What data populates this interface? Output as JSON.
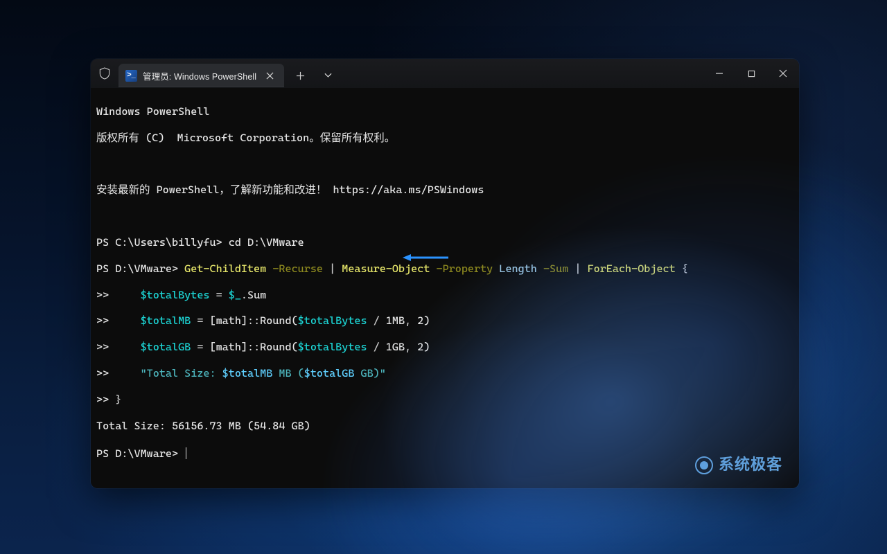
{
  "titlebar": {
    "tab_title": "管理员: Windows PowerShell",
    "ps_glyph": ">_"
  },
  "terminal": {
    "banner1": "Windows PowerShell",
    "banner2": "版权所有 (C)  Microsoft Corporation。保留所有权利。",
    "install_prefix": "安装最新的 PowerShell，了解新功能和改进！",
    "install_url": "https://aka.ms/PSWindows",
    "prompt1": "PS C:\\Users\\billyfu> ",
    "cmd1": "cd D:\\VMware",
    "prompt2": "PS D:\\VMware> ",
    "cont": ">>",
    "tok": {
      "getchilditem": "Get-ChildItem",
      "recurse": "-Recurse",
      "pipe": "|",
      "measure": "Measure-Object",
      "property": "-Property",
      "length": "Length",
      "sum": "-Sum",
      "foreach": "ForEach-Object",
      "lbrace": "{",
      "rbrace": "}",
      "totalBytes": "$totalBytes",
      "totalMB": "$totalMB",
      "totalGB": "$totalGB",
      "eq": " = ",
      "underscore": "$_",
      "dotSum": ".Sum",
      "mathRound": "[math]::Round(",
      "div": " / ",
      "mb": "1MB",
      "gb": "1GB",
      "comma2": ", ",
      "two": "2",
      "rparen": ")",
      "str_open": "\"Total Size: ",
      "str_mb_lbl": " MB (",
      "str_gb_lbl": " GB)\""
    },
    "output": "Total Size: 56156.73 MB (54.84 GB)",
    "prompt3": "PS D:\\VMware> "
  },
  "watermark": {
    "text": "系统极客"
  },
  "colors": {
    "arrow": "#2b93ff"
  }
}
